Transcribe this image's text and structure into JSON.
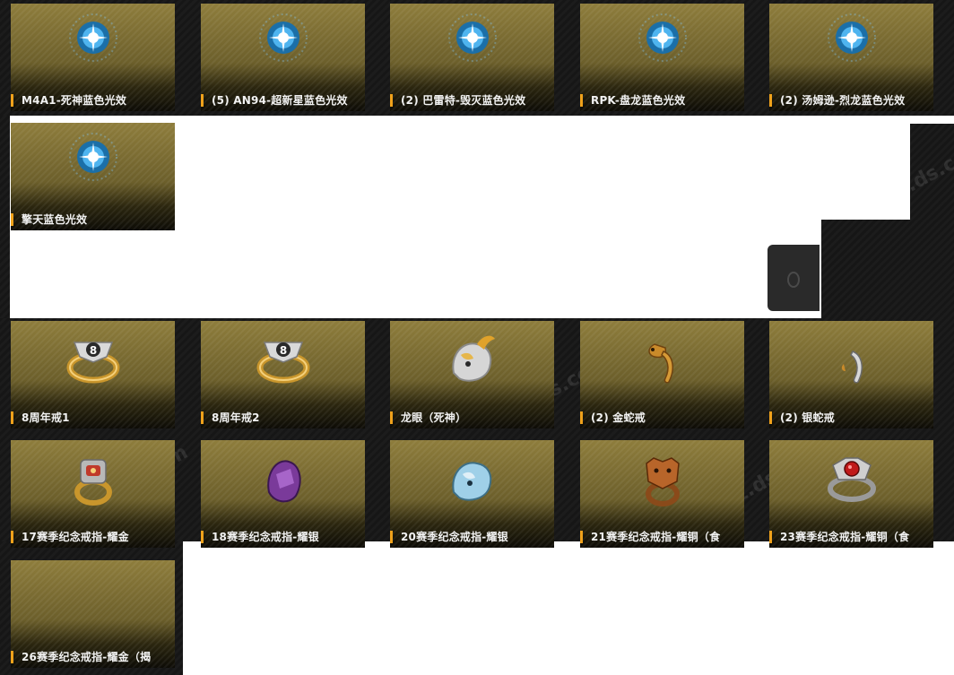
{
  "watermark": "pz.ds.com",
  "colors": {
    "accent": "#f0a21b",
    "card_gold": "#8e7d3c"
  },
  "rows": [
    [
      {
        "name": "M4A1-死神蓝色光效",
        "icon": "blue-glow-effect-icon"
      },
      {
        "name": "(5) AN94-超新星蓝色光效",
        "icon": "blue-glow-effect-icon"
      },
      {
        "name": "(2) 巴雷特-毁灭蓝色光效",
        "icon": "blue-glow-effect-icon"
      },
      {
        "name": "RPK-盘龙蓝色光效",
        "icon": "blue-glow-effect-icon"
      },
      {
        "name": "(2) 汤姆逊-烈龙蓝色光效",
        "icon": "blue-glow-effect-icon"
      }
    ],
    [
      {
        "name": "擎天蓝色光效",
        "icon": "blue-glow-effect-icon"
      }
    ],
    [
      {
        "name": "8周年戒1",
        "icon": "gold-ring-icon"
      },
      {
        "name": "8周年戒2",
        "icon": "gold-ring-icon"
      },
      {
        "name": "龙眼（死神）",
        "icon": "dragon-ring-icon"
      },
      {
        "name": "(2) 金蛇戒",
        "icon": "gold-snake-ring-icon"
      },
      {
        "name": "(2) 银蛇戒",
        "icon": "silver-snake-ring-icon"
      }
    ],
    [
      {
        "name": "17赛季纪念戒指-耀金",
        "icon": "season-ring-gold-icon"
      },
      {
        "name": "18赛季纪念戒指-耀银",
        "icon": "season-ring-purple-icon"
      },
      {
        "name": "20赛季纪念戒指-耀银",
        "icon": "season-ring-dragon-icon"
      },
      {
        "name": "21赛季纪念戒指-耀铜（食",
        "icon": "season-ring-tiger-icon"
      },
      {
        "name": "23赛季纪念戒指-耀铜（食",
        "icon": "season-ring-ruby-icon"
      }
    ],
    [
      {
        "name": "26赛季纪念戒指-耀金（揭",
        "icon": "empty-item-icon"
      }
    ]
  ]
}
